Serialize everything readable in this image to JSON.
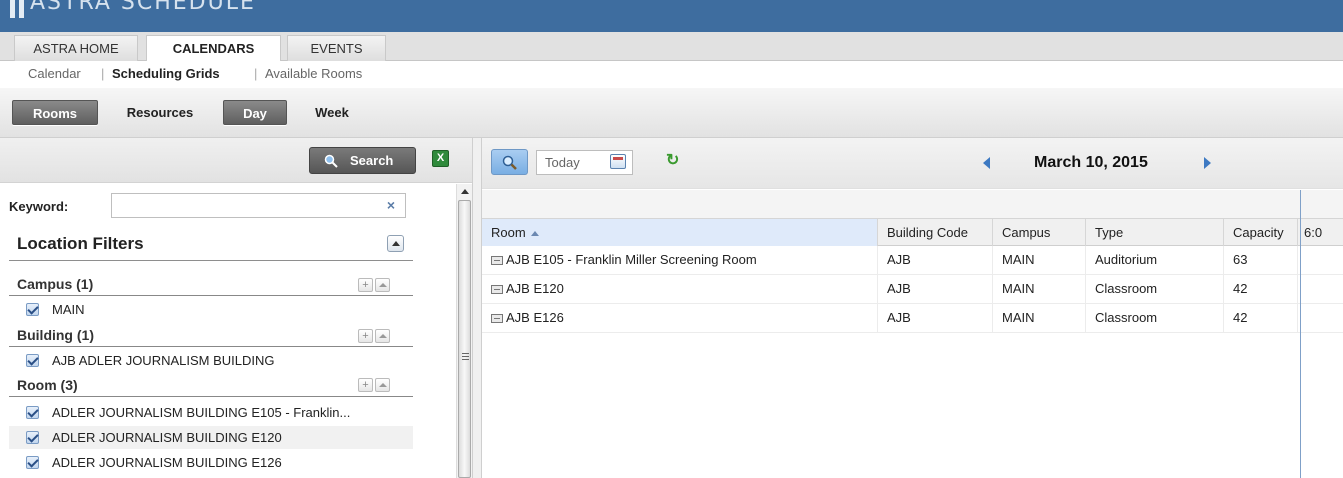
{
  "app": {
    "logo_text": "ASTRA SCHEDULE"
  },
  "top_tabs": [
    {
      "label": "ASTRA HOME"
    },
    {
      "label": "CALENDARS"
    },
    {
      "label": "EVENTS"
    }
  ],
  "sub_nav": {
    "calendar": "Calendar",
    "scheduling_grids": "Scheduling Grids",
    "available_rooms": "Available Rooms",
    "separator": "|"
  },
  "toolbar": {
    "rooms": "Rooms",
    "resources": "Resources",
    "day": "Day",
    "week": "Week"
  },
  "left_panel": {
    "search_label": "Search",
    "excel_icon_glyph": "X",
    "keyword_label": "Keyword:",
    "keyword_value": "",
    "clear_glyph": "×",
    "location_filters_title": "Location Filters",
    "groups": {
      "campus": {
        "title": "Campus (1)",
        "items": [
          "MAIN"
        ]
      },
      "building": {
        "title": "Building (1)",
        "items": [
          "AJB ADLER JOURNALISM BUILDING"
        ]
      },
      "room": {
        "title": "Room (3)",
        "items": [
          "ADLER JOURNALISM BUILDING E105 - Franklin...",
          "ADLER JOURNALISM BUILDING E120",
          "ADLER JOURNALISM BUILDING E126"
        ]
      }
    },
    "plus_glyph": "+"
  },
  "right_panel": {
    "date_placeholder": "Today",
    "current_date": "March 10, 2015",
    "refresh_glyph": "↻",
    "columns": {
      "room": "Room",
      "building_code": "Building Code",
      "campus": "Campus",
      "type": "Type",
      "capacity": "Capacity",
      "time": "6:0"
    },
    "rows": [
      {
        "room": "AJB E105 - Franklin Miller Screening Room",
        "building_code": "AJB",
        "campus": "MAIN",
        "type": "Auditorium",
        "capacity": "63"
      },
      {
        "room": "AJB E120",
        "building_code": "AJB",
        "campus": "MAIN",
        "type": "Classroom",
        "capacity": "42"
      },
      {
        "room": "AJB E126",
        "building_code": "AJB",
        "campus": "MAIN",
        "type": "Classroom",
        "capacity": "42"
      }
    ]
  },
  "colors": {
    "banner": "#3e6d9f",
    "accent_blue": "#3d79c2",
    "active_button": "#6b6b6b"
  }
}
